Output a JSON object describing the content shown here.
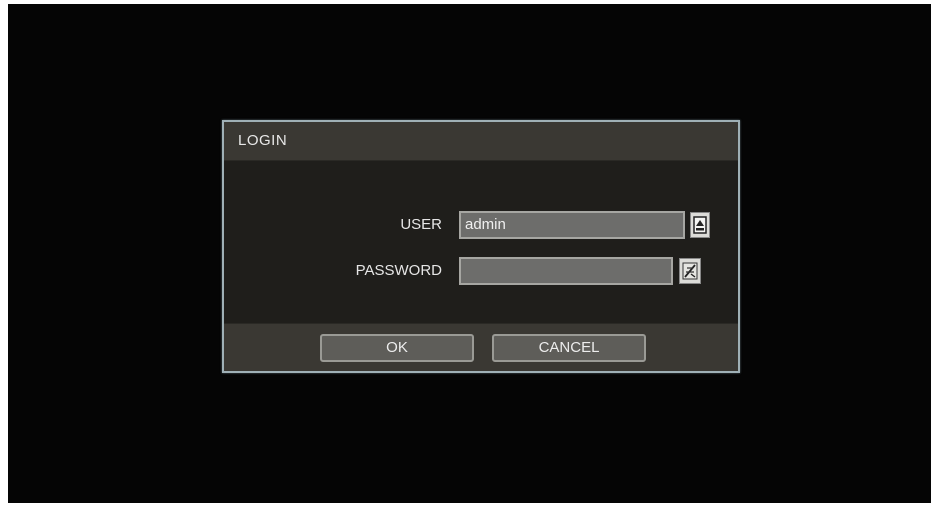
{
  "dialog": {
    "title": "LOGIN",
    "user": {
      "label": "USER",
      "value": "admin",
      "icon": "user-select-icon"
    },
    "password": {
      "label": "PASSWORD",
      "value": "",
      "icon": "virtual-keyboard-icon"
    },
    "buttons": {
      "ok": "OK",
      "cancel": "CANCEL"
    }
  },
  "colors": {
    "background": "#050505",
    "dialog_border": "#9fb0b6",
    "bar": "#3a3833",
    "field": "#6d6d6b"
  }
}
